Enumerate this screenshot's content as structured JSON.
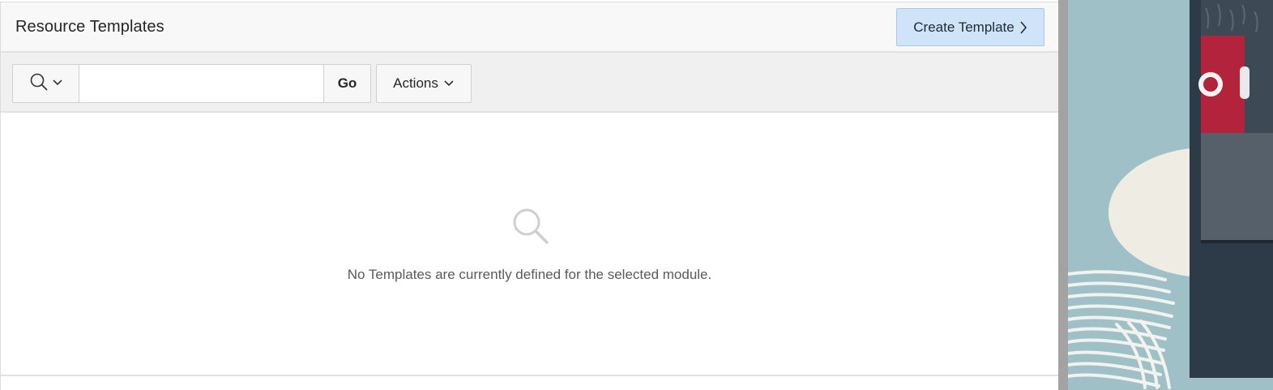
{
  "region": {
    "title": "Resource Templates",
    "create_button_label": "Create Template"
  },
  "toolbar": {
    "search_menu_icon": "search-icon",
    "search_placeholder": "",
    "search_value": "",
    "go_label": "Go",
    "actions_label": "Actions"
  },
  "body": {
    "empty_icon": "search-icon",
    "empty_message": "No Templates are currently defined for the selected module."
  },
  "colors": {
    "create_button_bg": "#cfe3f9",
    "header_bg": "#f8f8f8",
    "toolbar_bg": "#f0f0f0",
    "decor_teal": "#9fc0c6",
    "decor_cream": "#efece4",
    "video_dark": "#2d3b48",
    "video_red": "#b3233b"
  }
}
